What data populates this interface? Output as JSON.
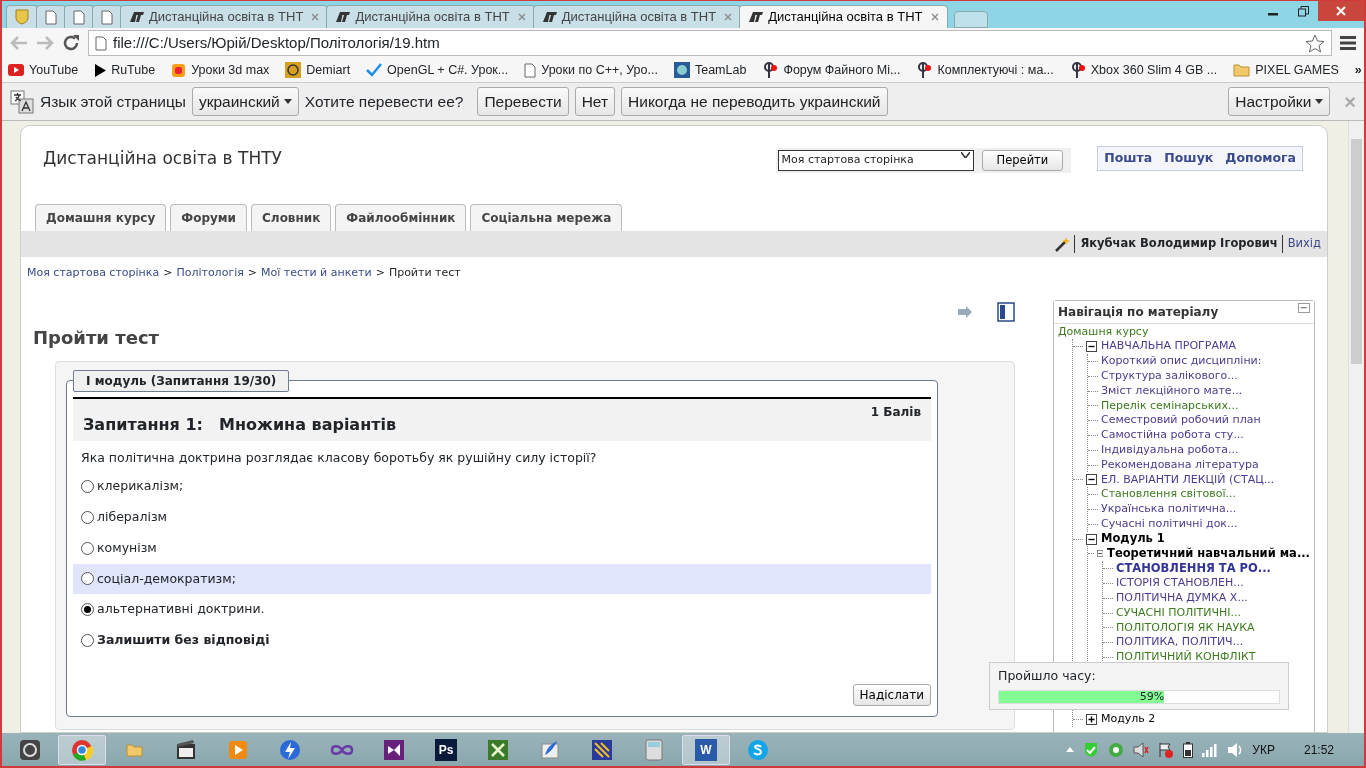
{
  "browser": {
    "tabs": [
      {
        "kind": "shield",
        "selected": false
      },
      {
        "kind": "page",
        "selected": false
      },
      {
        "kind": "page",
        "selected": false
      },
      {
        "kind": "page",
        "selected": false
      },
      {
        "kind": "site",
        "title": "Дистанційна освіта в ТНТ",
        "selected": false
      },
      {
        "kind": "site",
        "title": "Дистанційна освіта в ТНТ",
        "selected": false
      },
      {
        "kind": "site",
        "title": "Дистанційна освіта в ТНТ",
        "selected": false
      },
      {
        "kind": "site",
        "title": "Дистанційна освіта в ТНТ",
        "selected": true
      }
    ],
    "address": "file:///C:/Users/Юрій/Desktop/Політологія/19.htm",
    "bookmarks": [
      {
        "kind": "youtube",
        "label": "YouTube"
      },
      {
        "kind": "play",
        "label": "RuTube"
      },
      {
        "kind": "cube",
        "label": "Уроки 3d max"
      },
      {
        "kind": "demiart",
        "label": "Demiart"
      },
      {
        "kind": "check",
        "label": "OpenGL + C#. Урок..."
      },
      {
        "kind": "page",
        "label": "Уроки по С++, Уро..."
      },
      {
        "kind": "teamlab",
        "label": "TeamLab"
      },
      {
        "kind": "forum",
        "label": "Форум Файного Мі..."
      },
      {
        "kind": "forum",
        "label": "Комплектуючі : ма..."
      },
      {
        "kind": "forum",
        "label": "Xbox 360 Slim 4 GB ..."
      },
      {
        "kind": "folder",
        "label": "PIXEL GAMES"
      }
    ],
    "bookmarks_more": "»",
    "translate_bar": {
      "prompt": "Язык этой страницы",
      "language": "украинский",
      "question": "Хотите перевести ее?",
      "buttons": [
        "Перевести",
        "Нет",
        "Никогда не переводить украинский"
      ],
      "settings": "Настройки",
      "close": "×"
    }
  },
  "site": {
    "title": "Дистанційна освіта в ТНТУ",
    "jump_select": "Моя стартова сторінка",
    "jump_button": "Перейти",
    "links": [
      "Пошта",
      "Пошук",
      "Допомога"
    ],
    "tabs": [
      "Домашня курсу",
      "Форуми",
      "Словник",
      "Файлообмінник",
      "Соціальна мережа"
    ],
    "user": "Якубчак Володимир Ігорович",
    "logout": "Вихід",
    "breadcrumb": [
      {
        "label": "Моя стартова сторінка",
        "link": true
      },
      {
        "label": "Політологія",
        "link": true
      },
      {
        "label": "Мої тести й анкети",
        "link": true
      },
      {
        "label": "Пройти тест",
        "link": false
      }
    ],
    "breadcrumb_separator": ">"
  },
  "quiz": {
    "title": "Пройти тест",
    "legend": "І модуль (Запитання 19/30)",
    "question_number": "Запитання 1:",
    "question_type": "Множина варіантів",
    "points": "1 Балів",
    "question": "Яка політична доктрина розглядає класову боротьбу як рушійну силу історії?",
    "options": [
      {
        "label": "клерикалізм;",
        "selected": false,
        "highlighted": false,
        "bold": false
      },
      {
        "label": "лібералізм",
        "selected": false,
        "highlighted": false,
        "bold": false
      },
      {
        "label": "комунізм",
        "selected": false,
        "highlighted": false,
        "bold": false
      },
      {
        "label": "соціал-демократизм;",
        "selected": false,
        "highlighted": true,
        "bold": false
      },
      {
        "label": "альтернативні доктрини.",
        "selected": true,
        "highlighted": false,
        "bold": false
      },
      {
        "label": "Залишити без відповіді",
        "selected": false,
        "highlighted": false,
        "bold": true
      }
    ],
    "submit": "Надіслати"
  },
  "navigation": {
    "title": "Навігація по матеріалу",
    "collapse": "−",
    "tree": {
      "label": "Домашня курсу",
      "color": "#3d7a1f",
      "bold": false,
      "children": [
        {
          "label": "НАВЧАЛЬНА ПРОГРАМА",
          "color": "#4b3b8f",
          "bold": false,
          "expanded": true,
          "children": [
            {
              "label": "Короткий опис дисципліни:",
              "color": "#4b3b8f",
              "bold": false
            },
            {
              "label": "Структура залікового...",
              "color": "#4b3b8f",
              "bold": false
            },
            {
              "label": "Зміст лекційного мате...",
              "color": "#4b3b8f",
              "bold": false
            },
            {
              "label": "Перелік семінарських...",
              "color": "#3d7a1f",
              "bold": false
            },
            {
              "label": "Семестровий робочий план",
              "color": "#4b3b8f",
              "bold": false
            },
            {
              "label": "Самостійна робота сту...",
              "color": "#4b3b8f",
              "bold": false
            },
            {
              "label": "Індивідуальна робота...",
              "color": "#4b3b8f",
              "bold": false
            },
            {
              "label": "Рекомендована література",
              "color": "#4b3b8f",
              "bold": false
            }
          ]
        },
        {
          "label": "ЕЛ. ВАРІАНТИ ЛЕКЦІЙ (СТАЦ...",
          "color": "#4b3b8f",
          "bold": false,
          "expanded": true,
          "children": [
            {
              "label": "Становлення світової...",
              "color": "#3d7a1f",
              "bold": false
            },
            {
              "label": "Українська політична...",
              "color": "#4b3b8f",
              "bold": false
            },
            {
              "label": "Сучасні політичні док...",
              "color": "#4b3b8f",
              "bold": false
            }
          ]
        },
        {
          "label": "Модуль 1",
          "color": "#000000",
          "bold": true,
          "expanded": true,
          "children": [
            {
              "label": "Теоретичний навчальний ма...",
              "color": "#000000",
              "bold": true,
              "expanded": true,
              "children": [
                {
                  "label": "СТАНОВЛЕННЯ ТА РО...",
                  "color": "#333399",
                  "bold": true
                },
                {
                  "label": "ІСТОРІЯ СТАНОВЛЕН...",
                  "color": "#4b3b8f",
                  "bold": false
                },
                {
                  "label": "ПОЛІТИЧНА ДУМКА Х...",
                  "color": "#4b3b8f",
                  "bold": false
                },
                {
                  "label": "СУЧАСНІ ПОЛІТИЧНІ...",
                  "color": "#3d7a1f",
                  "bold": false
                },
                {
                  "label": "ПОЛІТОЛОГІЯ ЯК НАУКА",
                  "color": "#3d7a1f",
                  "bold": false
                },
                {
                  "label": "ПОЛІТИКА, ПОЛІТИЧ...",
                  "color": "#4b3b8f",
                  "bold": false
                },
                {
                  "label": "ПОЛІТИЧНИЙ КОНФЛІКТ",
                  "color": "#3d7a1f",
                  "bold": false
                }
              ]
            }
          ]
        },
        {
          "label": "Модуль 2",
          "color": "#000000",
          "bold": false,
          "expanded": false
        }
      ]
    }
  },
  "timer": {
    "label": "Пройшло часу:",
    "level": 0.59,
    "reading": "59%"
  },
  "taskbar": {
    "apps": [
      {
        "kind": "app",
        "selected": false
      },
      {
        "kind": "chrome",
        "selected": true
      },
      {
        "kind": "folder",
        "selected": false
      },
      {
        "kind": "film",
        "selected": false
      },
      {
        "kind": "player",
        "selected": false
      },
      {
        "kind": "bolt",
        "selected": false
      },
      {
        "kind": "infinity",
        "selected": false
      },
      {
        "kind": "studio",
        "selected": false
      },
      {
        "kind": "letter",
        "label": "Ps",
        "selected": false
      },
      {
        "kind": "sheet",
        "selected": false
      },
      {
        "kind": "feather",
        "selected": false
      },
      {
        "kind": "stripes",
        "selected": false
      },
      {
        "kind": "calculator",
        "selected": false
      },
      {
        "kind": "letter",
        "label": "W",
        "selected": true
      },
      {
        "kind": "skype",
        "selected": false
      }
    ],
    "language": "УКР",
    "time": "21:52"
  }
}
